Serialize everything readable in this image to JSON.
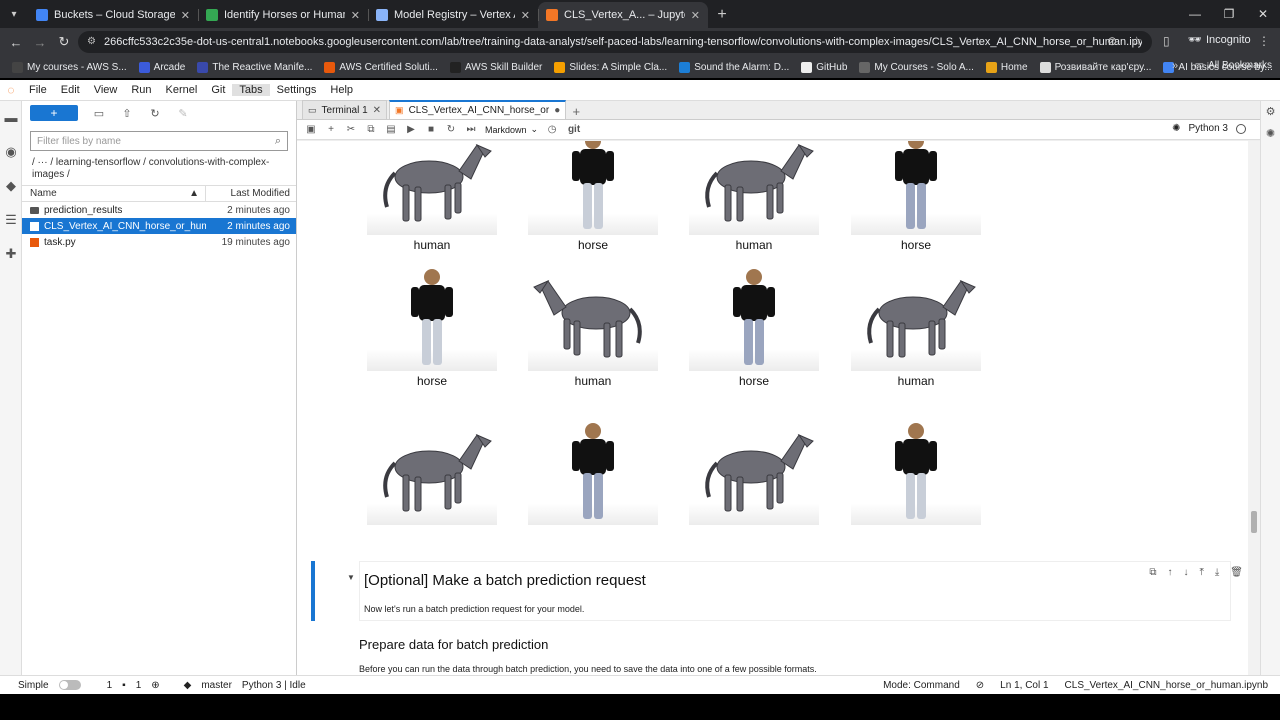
{
  "browser": {
    "tabs": [
      {
        "title": "Buckets – Cloud Storage – qwikl",
        "favicon_color": "#4285f4",
        "active": false
      },
      {
        "title": "Identify Horses or Humans with",
        "favicon_color": "#34a853",
        "active": false
      },
      {
        "title": "Model Registry – Vertex AI – qw",
        "favicon_color": "#8ab4f8",
        "active": false
      },
      {
        "title": "CLS_Vertex_A... – JupyterLab",
        "favicon_color": "#f37726",
        "active": true
      }
    ],
    "url": "266cffc533c2c35e-dot-us-central1.notebooks.googleusercontent.com/lab/tree/training-data-analyst/self-paced-labs/learning-tensorflow/convolutions-with-complex-images/CLS_Vertex_AI_CNN_horse_or_human.ipynb",
    "profile": "Incognito",
    "bookmarks": [
      {
        "label": "My courses - AWS S...",
        "color": "#444"
      },
      {
        "label": "Arcade",
        "color": "#3b5bdb"
      },
      {
        "label": "The Reactive Manife...",
        "color": "#3949ab"
      },
      {
        "label": "AWS Certified Soluti...",
        "color": "#e8590c"
      },
      {
        "label": "AWS Skill Builder",
        "color": "#222"
      },
      {
        "label": "Slides: A Simple Cla...",
        "color": "#f59f00"
      },
      {
        "label": "Sound the Alarm: D...",
        "color": "#1c7ed6"
      },
      {
        "label": "GitHub",
        "color": "#eee"
      },
      {
        "label": "My Courses - Solo A...",
        "color": "#666"
      },
      {
        "label": "Home",
        "color": "#e8a317"
      },
      {
        "label": "Розвивайте кар'єру...",
        "color": "#ddd"
      },
      {
        "label": "AI basics course by...",
        "color": "#4285f4"
      }
    ],
    "all_bookmarks": "All Bookmarks"
  },
  "jupyter": {
    "menu": [
      "File",
      "Edit",
      "View",
      "Run",
      "Kernel",
      "Git",
      "Tabs",
      "Settings",
      "Help"
    ],
    "filebrowser": {
      "new_label": "+",
      "search_placeholder": "Filter files by name",
      "breadcrumb": "/   ···   / learning-tensorflow / convolutions-with-complex-images /",
      "col_name": "Name",
      "col_modified": "Last Modified",
      "files": [
        {
          "name": "prediction_results",
          "modified": "2 minutes ago",
          "type": "folder",
          "selected": false
        },
        {
          "name": "CLS_Vertex_AI_CNN_horse_or_human.ip...",
          "modified": "2 minutes ago",
          "type": "notebook",
          "selected": true
        },
        {
          "name": "task.py",
          "modified": "19 minutes ago",
          "type": "python",
          "selected": false
        }
      ]
    },
    "doc_tabs": [
      {
        "label": "Terminal 1",
        "active": false
      },
      {
        "label": "CLS_Vertex_AI_CNN_horse_or",
        "active": true
      }
    ],
    "toolbar": {
      "cell_type": "Markdown",
      "git": "git",
      "kernel": "Python 3"
    },
    "predictions": [
      {
        "label": "human",
        "subject": "horse"
      },
      {
        "label": "horse",
        "subject": "human"
      },
      {
        "label": "human",
        "subject": "horse"
      },
      {
        "label": "horse",
        "subject": "human"
      },
      {
        "label": "horse",
        "subject": "human"
      },
      {
        "label": "human",
        "subject": "horse"
      },
      {
        "label": "horse",
        "subject": "human"
      },
      {
        "label": "human",
        "subject": "horse"
      },
      {
        "label": "",
        "subject": "horse"
      },
      {
        "label": "",
        "subject": "human"
      },
      {
        "label": "",
        "subject": "horse"
      },
      {
        "label": "",
        "subject": "human"
      }
    ],
    "markdown": {
      "heading": "[Optional] Make a batch prediction request",
      "paragraph": "Now let's run a batch prediction request for your model.",
      "subheading": "Prepare data for batch prediction",
      "paragraph2": "Before you can run the data through batch prediction, you need to save the data into one of a few possible formats."
    },
    "status": {
      "mode_simple": "Simple",
      "n1": "1",
      "n2": "1",
      "branch": "master",
      "kernel_status": "Python 3 | Idle",
      "mode": "Mode: Command",
      "cursor": "Ln 1, Col 1",
      "filename": "CLS_Vertex_AI_CNN_horse_or_human.ipynb"
    }
  }
}
